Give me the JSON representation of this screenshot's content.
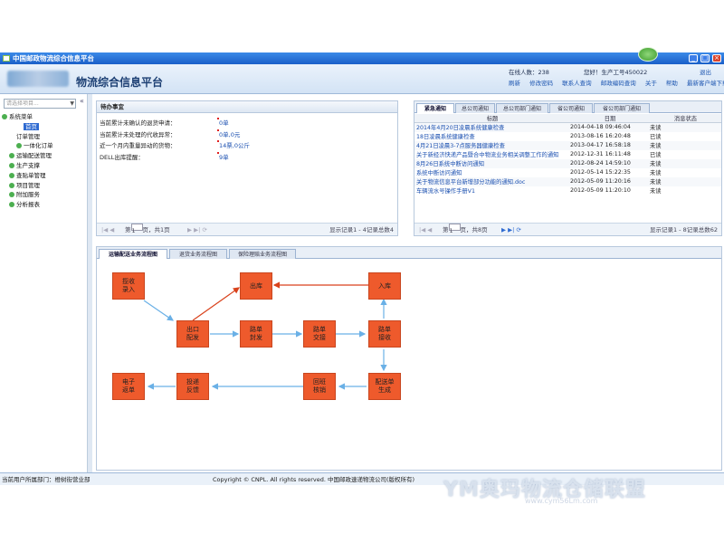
{
  "window": {
    "title": "中国邮政物流综合信息平台"
  },
  "header": {
    "app_title": "物流综合信息平台",
    "online_label": "在线人数：238",
    "user_label": "您好！生产工号450022",
    "logout": "退出",
    "links": [
      "刷新",
      "修改密码",
      "联系人查询",
      "邮政编码查询",
      "关于",
      "帮助",
      "最新客户端下载"
    ]
  },
  "sidebar": {
    "search_placeholder": "请选择项目...",
    "collapse": "«",
    "tree": [
      {
        "label": "系统菜单",
        "level": 0
      },
      {
        "label": "首页",
        "level": 2,
        "selected": true
      },
      {
        "label": "订单管理",
        "level": 1
      },
      {
        "label": "一体化订单",
        "level": 2
      },
      {
        "label": "运输配送管理",
        "level": 1
      },
      {
        "label": "生产支撑",
        "level": 1
      },
      {
        "label": "查贴单管理",
        "level": 1
      },
      {
        "label": "项目管理",
        "level": 1
      },
      {
        "label": "附加服务",
        "level": 1
      },
      {
        "label": "分析报表",
        "level": 1
      }
    ]
  },
  "todo": {
    "title": "待办事宜",
    "rows": [
      {
        "label": "当前累计未确认的退货申请：",
        "value": "0单"
      },
      {
        "label": "当前累计未处理的代收异常：",
        "value": "0单,0元"
      },
      {
        "label": "近一个月内重量异动的货物：",
        "value": "14票,0公斤"
      },
      {
        "label": "DELL出库提醒：",
        "value": "9单"
      }
    ],
    "pager": {
      "page_prefix": "第",
      "page_value": "1",
      "page_suffix": "页，共1页",
      "summary": "显示记录1 - 4记录总数4"
    }
  },
  "notices": {
    "tabs": [
      "紧急通知",
      "总公司通知",
      "总公司部门通知",
      "省公司通知",
      "省公司部门通知"
    ],
    "columns": [
      "标题",
      "日期",
      "消息状态"
    ],
    "rows": [
      {
        "title": "2014年4月20日凌晨系统健康检查",
        "date": "2014-04-18 09:46:04",
        "status": "未读"
      },
      {
        "title": "18日凌晨系统健康检查",
        "date": "2013-08-16 16:20:48",
        "status": "已读"
      },
      {
        "title": "4月21日凌晨3-7点服务器健康检查",
        "date": "2013-04-17 16:58:18",
        "status": "未读"
      },
      {
        "title": "关于新经济快递产品暨合中物流业务相关调整工作的通知",
        "date": "2012-12-31 16:11:48",
        "status": "已读"
      },
      {
        "title": "8月26日系统中断访问通知",
        "date": "2012-08-24 14:59:10",
        "status": "未读"
      },
      {
        "title": "系统中断访问通知",
        "date": "2012-05-14 15:22:35",
        "status": "未读"
      },
      {
        "title": "关于物流信息平台新增部分功能的通知.doc",
        "date": "2012-05-09 11:20:16",
        "status": "未读"
      },
      {
        "title": "车辆流水号操作手册V1",
        "date": "2012-05-09 11:20:10",
        "status": "未读"
      }
    ],
    "pager": {
      "page_prefix": "第",
      "page_value": "1",
      "page_suffix": "页，共8页",
      "summary": "显示记录1 - 8记录总数62"
    }
  },
  "flow": {
    "tabs": [
      "运输配送业务流程图",
      "退货业务流程图",
      "保险理赔业务流程图"
    ],
    "boxes": {
      "b1": "揽收\n录入",
      "b2": "出库",
      "b3": "入库",
      "b4": "出口\n配发",
      "b5": "路单\n封发",
      "b6": "路单\n交接",
      "b7": "路单\n接收",
      "b8": "电子\n返单",
      "b9": "投递\n反馈",
      "b10": "回班\n核销",
      "b11": "配送单\n生成"
    }
  },
  "footer": {
    "dept": "当前用户所属部门：橙树街营业部",
    "copyright": "Copyright © CNPL. All rights reserved. 中国邮政速递物流公司(版权所有)"
  },
  "watermark": {
    "brand": "YM奥玛物流仓储联盟",
    "url": "www.cym56Lm.com"
  }
}
